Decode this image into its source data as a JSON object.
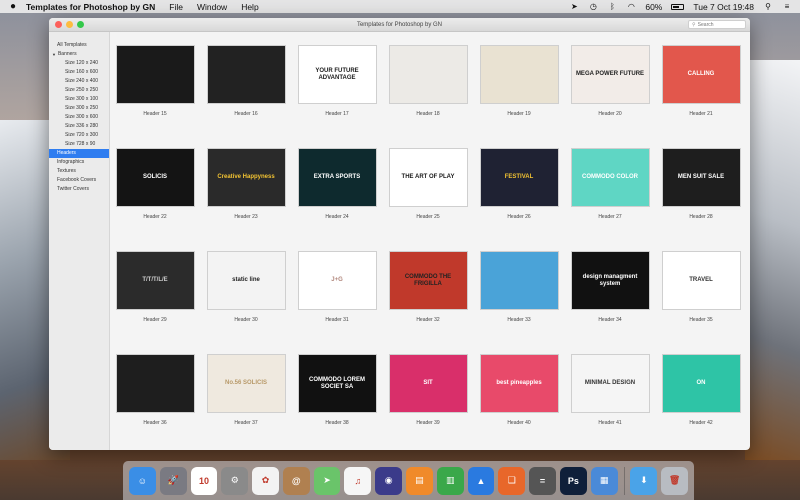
{
  "menubar": {
    "app_name": "Templates for Photoshop by GN",
    "menus": [
      "File",
      "Window",
      "Help"
    ],
    "battery_percent": "60%",
    "battery_level": 0.6,
    "datetime": "Tue 7 Oct  19:48"
  },
  "window": {
    "title": "Templates for Photoshop by GN",
    "search_placeholder": "Search"
  },
  "sidebar": {
    "items": [
      {
        "label": "All Templates",
        "level": 0
      },
      {
        "label": "Banners",
        "level": 0,
        "group": true
      },
      {
        "label": "Size 120 x 240",
        "level": 1
      },
      {
        "label": "Size 160 x 600",
        "level": 1
      },
      {
        "label": "Size 240 x 400",
        "level": 1
      },
      {
        "label": "Size 250 x 250",
        "level": 1
      },
      {
        "label": "Size 300 x 100",
        "level": 1
      },
      {
        "label": "Size 300 x 250",
        "level": 1
      },
      {
        "label": "Size 300 x 600",
        "level": 1
      },
      {
        "label": "Size 336 x 280",
        "level": 1
      },
      {
        "label": "Size 720 x 300",
        "level": 1
      },
      {
        "label": "Size 728 x 90",
        "level": 1
      },
      {
        "label": "Headers",
        "level": 0,
        "selected": true
      },
      {
        "label": "Infographics",
        "level": 0
      },
      {
        "label": "Textures",
        "level": 0
      },
      {
        "label": "Facebook Covers",
        "level": 0
      },
      {
        "label": "Twitter Covers",
        "level": 0
      }
    ]
  },
  "templates": [
    {
      "caption": "Header 15",
      "bg": "#1a1a1a",
      "fg": "#e05a5a",
      "text": ""
    },
    {
      "caption": "Header 16",
      "bg": "#222222",
      "fg": "#ffffff",
      "text": ""
    },
    {
      "caption": "Header 17",
      "bg": "#ffffff",
      "fg": "#1b1b1b",
      "text": "YOUR FUTURE ADVANTAGE"
    },
    {
      "caption": "Header 18",
      "bg": "#eceae6",
      "fg": "#555555",
      "text": ""
    },
    {
      "caption": "Header 19",
      "bg": "#e9e2d2",
      "fg": "#b88a3a",
      "text": ""
    },
    {
      "caption": "Header 20",
      "bg": "#f2ece8",
      "fg": "#222222",
      "text": "MEGA POWER FUTURE"
    },
    {
      "caption": "Header 21",
      "bg": "#e2574c",
      "fg": "#ffffff",
      "text": "CALLING"
    },
    {
      "caption": "Header 22",
      "bg": "#141414",
      "fg": "#ffffff",
      "text": "SOLICIS"
    },
    {
      "caption": "Header 23",
      "bg": "#2a2a2a",
      "fg": "#f1c232",
      "text": "Creative Happyness"
    },
    {
      "caption": "Header 24",
      "bg": "#0e2a2e",
      "fg": "#ffffff",
      "text": "EXTRA SPORTS"
    },
    {
      "caption": "Header 25",
      "bg": "#ffffff",
      "fg": "#1a1a1a",
      "text": "THE ART OF PLAY"
    },
    {
      "caption": "Header 26",
      "bg": "#1f2233",
      "fg": "#f1c232",
      "text": "FESTIVAL"
    },
    {
      "caption": "Header 27",
      "bg": "#5fd6c4",
      "fg": "#ffffff",
      "text": "COMMODO COLOR"
    },
    {
      "caption": "Header 28",
      "bg": "#1e1e1e",
      "fg": "#ffffff",
      "text": "MEN SUIT SALE"
    },
    {
      "caption": "Header 29",
      "bg": "#2b2b2b",
      "fg": "#cccccc",
      "text": "T/T/T/L/E"
    },
    {
      "caption": "Header 30",
      "bg": "#f3f3f3",
      "fg": "#222222",
      "text": "static line"
    },
    {
      "caption": "Header 31",
      "bg": "#ffffff",
      "fg": "#b0857a",
      "text": "J+G"
    },
    {
      "caption": "Header 32",
      "bg": "#c0392b",
      "fg": "#222222",
      "text": "COMMODO THE FRIGILLA"
    },
    {
      "caption": "Header 33",
      "bg": "#4aa3d8",
      "fg": "#ffffff",
      "text": ""
    },
    {
      "caption": "Header 34",
      "bg": "#111111",
      "fg": "#ffffff",
      "text": "design managment system"
    },
    {
      "caption": "Header 35",
      "bg": "#ffffff",
      "fg": "#333333",
      "text": "TRAVEL"
    },
    {
      "caption": "Header 36",
      "bg": "#1e1e1e",
      "fg": "#5ee0c0",
      "text": ""
    },
    {
      "caption": "Header 37",
      "bg": "#efe9df",
      "fg": "#b89a6a",
      "text": "No.56 SOLICIS"
    },
    {
      "caption": "Header 38",
      "bg": "#111111",
      "fg": "#ffffff",
      "text": "COMMODO LOREM SOCIET SA"
    },
    {
      "caption": "Header 39",
      "bg": "#d92f6a",
      "fg": "#ffffff",
      "text": "SIT"
    },
    {
      "caption": "Header 40",
      "bg": "#e84a6a",
      "fg": "#ffffff",
      "text": "best pineapples"
    },
    {
      "caption": "Header 41",
      "bg": "#f5f5f5",
      "fg": "#333333",
      "text": "MINIMAL DESIGN"
    },
    {
      "caption": "Header 42",
      "bg": "#2ec4a6",
      "fg": "#ffffff",
      "text": "ON"
    }
  ],
  "dock": [
    {
      "name": "finder",
      "color": "#3a8ee6",
      "glyph": "☺"
    },
    {
      "name": "launchpad",
      "color": "#7a7a82",
      "glyph": "🚀"
    },
    {
      "name": "calendar",
      "color": "#ffffff",
      "glyph": "10"
    },
    {
      "name": "system-preferences",
      "color": "#8a8a8a",
      "glyph": "⚙"
    },
    {
      "name": "photos",
      "color": "#f3f3f3",
      "glyph": "✿"
    },
    {
      "name": "contacts",
      "color": "#b08050",
      "glyph": "@"
    },
    {
      "name": "maps",
      "color": "#6ac46a",
      "glyph": "➤"
    },
    {
      "name": "itunes",
      "color": "#f6f6f6",
      "glyph": "♫"
    },
    {
      "name": "siri",
      "color": "#3b3b8a",
      "glyph": "◉"
    },
    {
      "name": "ibooks",
      "color": "#f08a2a",
      "glyph": "▤"
    },
    {
      "name": "numbers",
      "color": "#3aa84a",
      "glyph": "▥"
    },
    {
      "name": "keynote",
      "color": "#2a7ae0",
      "glyph": "▲"
    },
    {
      "name": "books",
      "color": "#e8672a",
      "glyph": "❑"
    },
    {
      "name": "calculator",
      "color": "#555555",
      "glyph": "="
    },
    {
      "name": "photoshop",
      "color": "#0f1f3a",
      "glyph": "Ps"
    },
    {
      "name": "preview",
      "color": "#4a8ad8",
      "glyph": "▦"
    },
    {
      "name": "downloads-folder",
      "color": "#4aa3e8",
      "glyph": "⬇"
    },
    {
      "name": "trash",
      "color": "#b8bcc2",
      "glyph": "🗑"
    }
  ]
}
